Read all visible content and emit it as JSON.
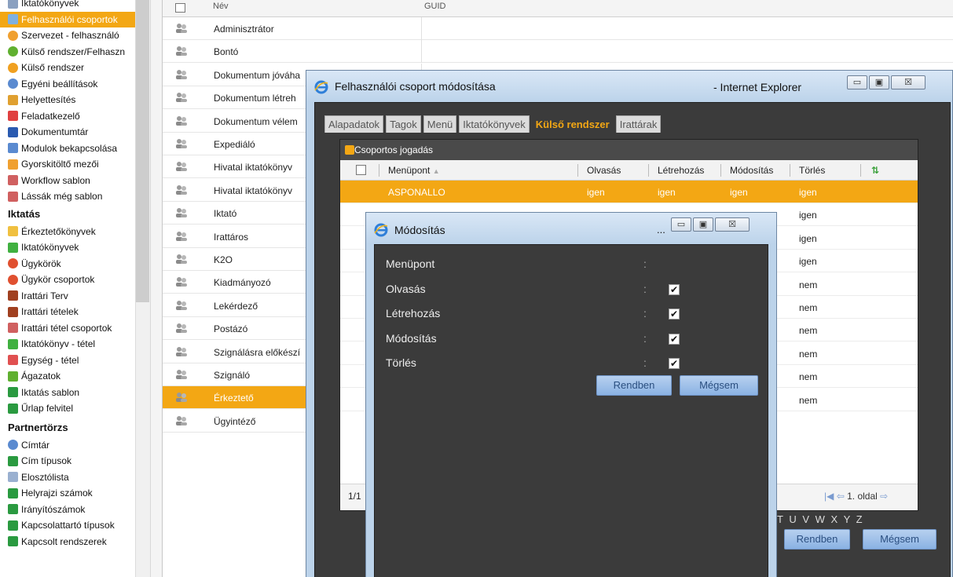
{
  "sidebar": {
    "items": [
      {
        "label": "Iktatókönyvek",
        "icon": "folder-icon",
        "color": "#8aa0c0"
      },
      {
        "label": "Felhasználói csoportok",
        "icon": "user-group-icon",
        "color": "#7fb0e0",
        "selected": true
      },
      {
        "label": "Szervezet - felhasználó",
        "icon": "globe-icon",
        "color": "#f0a030"
      },
      {
        "label": "Külső rendszer/Felhaszn",
        "icon": "globe-green-icon",
        "color": "#60b030"
      },
      {
        "label": "Külső rendszer",
        "icon": "circle-icon",
        "color": "#f0a020"
      },
      {
        "label": "Egyéni beállítások",
        "icon": "settings-icon",
        "color": "#5a8ad0"
      },
      {
        "label": "Helyettesítés",
        "icon": "users-icon",
        "color": "#e0a030"
      },
      {
        "label": "Feladatkezelő",
        "icon": "task-icon",
        "color": "#e04040"
      },
      {
        "label": "Dokumentumtár",
        "icon": "word-icon",
        "color": "#2a5ab0"
      },
      {
        "label": "Modulok bekapcsolása",
        "icon": "modules-icon",
        "color": "#5a8ad0"
      },
      {
        "label": "Gyorskitöltő mezői",
        "icon": "pencil-icon",
        "color": "#f0a030"
      },
      {
        "label": "Workflow sablon",
        "icon": "workflow-icon",
        "color": "#d06060"
      },
      {
        "label": "Lássák még sablon",
        "icon": "template-icon",
        "color": "#d06060"
      }
    ],
    "section_iktatas": "Iktatás",
    "iktatas_items": [
      {
        "label": "Érkeztetőkönyvek",
        "icon": "book-icon",
        "color": "#f0c040"
      },
      {
        "label": "Iktatókönyvek",
        "icon": "book-green-icon",
        "color": "#40b040"
      },
      {
        "label": "Ügykörök",
        "icon": "nodes-icon",
        "color": "#e05030"
      },
      {
        "label": "Ügykör csoportok",
        "icon": "nodes-group-icon",
        "color": "#e05030"
      },
      {
        "label": "Irattári Terv",
        "icon": "archive-icon",
        "color": "#a04020"
      },
      {
        "label": "Irattári tételek",
        "icon": "archive-items-icon",
        "color": "#a04020"
      },
      {
        "label": "Irattári tétel csoportok",
        "icon": "archive-group-icon",
        "color": "#d06060"
      },
      {
        "label": "Iktatókönyv - tétel",
        "icon": "book-item-icon",
        "color": "#40b040"
      },
      {
        "label": "Egység - tétel",
        "icon": "unit-icon",
        "color": "#e05050"
      },
      {
        "label": "Ágazatok",
        "icon": "branch-icon",
        "color": "#60b030"
      },
      {
        "label": "Iktatás sablon",
        "icon": "template-green-icon",
        "color": "#2a9a40"
      },
      {
        "label": "Űrlap felvitel",
        "icon": "form-icon",
        "color": "#2a9a40"
      }
    ],
    "section_partner": "Partnertörzs",
    "partner_items": [
      {
        "label": "Címtár",
        "icon": "directory-icon",
        "color": "#5a8ad0"
      },
      {
        "label": "Cím típusok",
        "icon": "address-type-icon",
        "color": "#2a9a40"
      },
      {
        "label": "Elosztólista",
        "icon": "list-icon",
        "color": "#9ab0d0"
      },
      {
        "label": "Helyrajzi számok",
        "icon": "parcel-icon",
        "color": "#2a9a40"
      },
      {
        "label": "Irányítószámok",
        "icon": "postal-icon",
        "color": "#2a9a40"
      },
      {
        "label": "Kapcsolattartó típusok",
        "icon": "contact-type-icon",
        "color": "#2a9a40"
      },
      {
        "label": "Kapcsolt rendszerek",
        "icon": "linked-icon",
        "color": "#2a9a40"
      }
    ]
  },
  "grid": {
    "header": {
      "name": "Név",
      "guid": "GUID"
    },
    "rows": [
      {
        "name": "Adminisztrátor"
      },
      {
        "name": "Bontó"
      },
      {
        "name": "Dokumentum jóváha"
      },
      {
        "name": "Dokumentum létreh"
      },
      {
        "name": "Dokumentum vélem"
      },
      {
        "name": "Expediáló"
      },
      {
        "name": "Hivatal iktatókönyv"
      },
      {
        "name": "Hivatal iktatókönyv"
      },
      {
        "name": "Iktató"
      },
      {
        "name": "Irattáros"
      },
      {
        "name": "K2O"
      },
      {
        "name": "Kiadmányozó"
      },
      {
        "name": "Lekérdező"
      },
      {
        "name": "Postázó"
      },
      {
        "name": "Szignálásra előkészí"
      },
      {
        "name": "Szignáló"
      },
      {
        "name": "Érkeztető",
        "selected": true
      },
      {
        "name": "Ügyintéző"
      }
    ]
  },
  "outer_window": {
    "title": "Felhasználói csoport módosítása",
    "browser": "- Internet Explorer",
    "tabs": [
      "Alapadatok",
      "Tagok",
      "Menü",
      "Iktatókönyvek",
      "Külső rendszer",
      "Irattárak"
    ],
    "active_tab": 4,
    "panel_title": "Csoportos jogadás",
    "columns": [
      "Menüpont",
      "Olvasás",
      "Létrehozás",
      "Módosítás",
      "Törlés"
    ],
    "rows": [
      {
        "menupont": "ASPONALLO",
        "olvasas": "igen",
        "letrehozas": "igen",
        "modositas": "igen",
        "torles": "igen",
        "selected": true
      },
      {
        "torles": "igen"
      },
      {
        "torles": "igen"
      },
      {
        "torles": "igen"
      },
      {
        "torles": "nem"
      },
      {
        "torles": "nem"
      },
      {
        "torles": "nem"
      },
      {
        "torles": "nem"
      },
      {
        "torles": "nem"
      },
      {
        "torles": "nem"
      }
    ],
    "pager_left": "1/1",
    "pager_right": "1. oldal",
    "alphabet": "S T U V W X Y Z",
    "ok_label": "Rendben",
    "cancel_label": "Mégsem"
  },
  "inner_window": {
    "title": "Módosítás",
    "dots": "...",
    "fields": [
      {
        "label": "Menüpont",
        "checkbox": false
      },
      {
        "label": "Olvasás",
        "checkbox": true
      },
      {
        "label": "Létrehozás",
        "checkbox": true
      },
      {
        "label": "Módosítás",
        "checkbox": true
      },
      {
        "label": "Törlés",
        "checkbox": true
      }
    ],
    "colon": ":",
    "check_mark": "✔",
    "ok_label": "Rendben",
    "cancel_label": "Mégsem"
  },
  "window_buttons": {
    "minimize": "▭",
    "maximize": "▣",
    "close": "☒"
  },
  "colors": {
    "accent": "#f3a714",
    "dialog_bg": "#3b3b3b",
    "button": "#8ab2e3"
  }
}
